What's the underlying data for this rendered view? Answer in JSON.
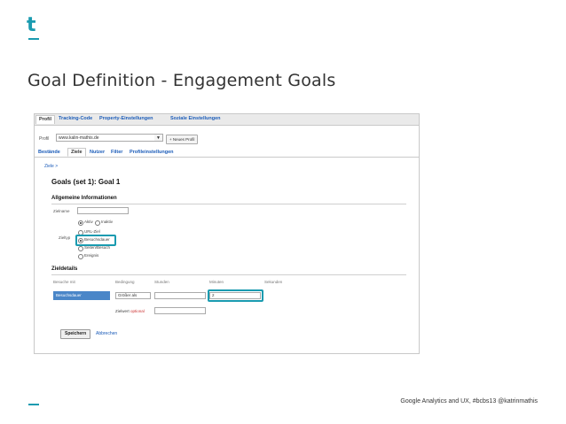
{
  "slide": {
    "logo_glyph": "t",
    "title": "Goal Definition - Engagement Goals",
    "footer": "Google Analytics and UX, #bcbs13 @katrinmathis",
    "accent_color": "#1a9bb0"
  },
  "ga": {
    "top_tabs": [
      "Profil",
      "Tracking-Code",
      "Property-Einstellungen",
      "Soziale Einstellungen"
    ],
    "profile_label": "Profil",
    "profile_value": "www.kalin-mathis.de",
    "profile_arrow": "▼",
    "new_profile_button": "+ Neues Profil",
    "sub_tabs": [
      "Bestände",
      "Ziele",
      "Nutzer",
      "Filter",
      "Profileinstellungen"
    ],
    "back_link": "Ziele >",
    "goal_heading": "Goals (set 1): Goal 1",
    "general_section": "Allgemeine Informationen",
    "goal_name_label": "Zielname",
    "goal_type_label": "Zieltyp",
    "status_options": [
      "Aktiv",
      "Inaktiv"
    ],
    "type_options": [
      "URL-Ziel",
      "Besuchsdauer",
      "Seiten/Besuch",
      "Ereignis"
    ],
    "details_section": "Zieldetails",
    "columns": [
      "Besuche mit",
      "Bedingung",
      "Stunden",
      "Minuten",
      "Sekunden"
    ],
    "row_label": "Besuchsdauer",
    "condition_value": "Größer als",
    "minutes_value": "2",
    "goal_value_label": "Zielwert",
    "goal_value_hint": "optional",
    "save_button": "Speichern",
    "cancel_link": "Abbrechen"
  }
}
